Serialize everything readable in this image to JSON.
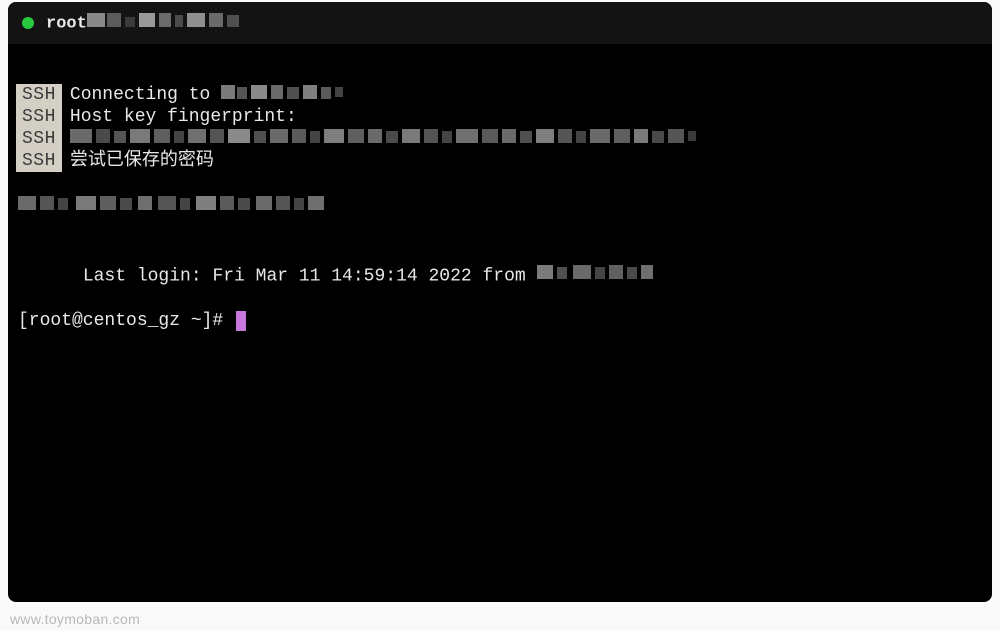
{
  "titleBar": {
    "visiblePrefix": "root"
  },
  "ssh": {
    "tag": "SSH",
    "lines": [
      {
        "text": "Connecting to ",
        "hasBlur": true
      },
      {
        "text": "Host key fingerprint:",
        "hasBlur": false
      },
      {
        "text": "",
        "hasBlur": true,
        "fullBlur": true
      },
      {
        "text": "尝试已保存的密码",
        "hasBlur": false
      }
    ]
  },
  "lastLogin": {
    "prefix": "Last login: ",
    "datetime": "Fri Mar 11 14:59:14 2022",
    "fromLabel": " from "
  },
  "prompt": "[root@centos_gz ~]# ",
  "watermark": "www.toymoban.com"
}
